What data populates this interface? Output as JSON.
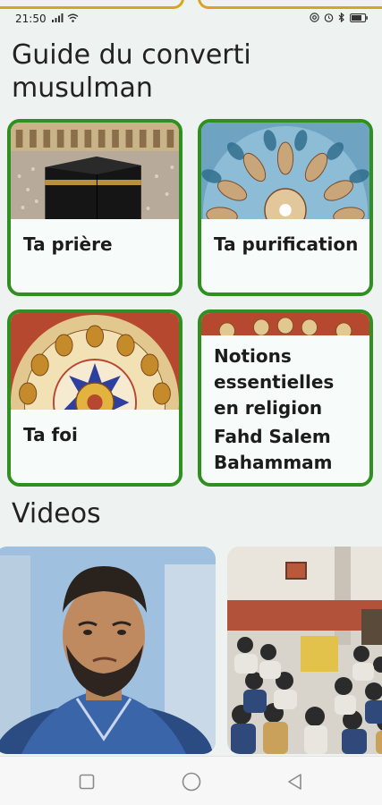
{
  "status_bar": {
    "time": "21:50",
    "icons": [
      "signal-icon",
      "wifi-icon",
      "at-icon",
      "alarm-icon",
      "bluetooth-icon",
      "battery-icon"
    ]
  },
  "guide": {
    "title": "Guide du converti musulman",
    "cards": [
      {
        "label": "Ta prière",
        "image": "kaaba-image"
      },
      {
        "label": "Ta purification",
        "image": "mosaic-dome-image"
      },
      {
        "label": "Ta foi",
        "image": "ornament-dome-image"
      },
      {
        "label": "Notions essentielles en religion",
        "author": "Fahd Salem Bahammam",
        "image": "ornament-strip-image"
      }
    ]
  },
  "videos": {
    "title": "Videos",
    "items": [
      {
        "image": "speaker-portrait-image"
      },
      {
        "image": "lecture-hall-image"
      }
    ]
  },
  "nav_bar": {
    "buttons": [
      "recents-square-icon",
      "home-circle-icon",
      "back-triangle-icon"
    ]
  },
  "colors": {
    "card_border": "#2f8f1f",
    "background": "#eef3f2",
    "peek_border": "#d9a520"
  }
}
